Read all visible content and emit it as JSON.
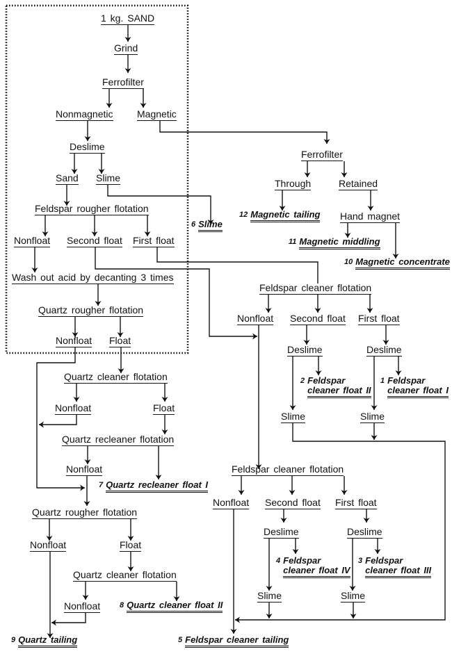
{
  "nodes": {
    "sand": "1 kg. SAND",
    "grind": "Grind",
    "ferrofilter": "Ferrofilter",
    "nonmagnetic": "Nonmagnetic",
    "magnetic": "Magnetic",
    "deslime": "Deslime",
    "sand_fraction": "Sand",
    "slime": "Slime",
    "feldspar_rougher": "Feldspar rougher flotation",
    "nonfloat": "Nonfloat",
    "second_float": "Second float",
    "first_float": "First float",
    "wash": "Wash out acid by decanting 3 times",
    "quartz_rougher": "Quartz rougher flotation",
    "float": "Float",
    "quartz_cleaner": "Quartz cleaner flotation",
    "quartz_recleaner": "Quartz recleaner flotation",
    "through": "Through",
    "retained": "Retained",
    "hand_magnet": "Hand magnet",
    "feldspar_cleaner": "Feldspar cleaner flotation"
  },
  "products": [
    {
      "num": "1",
      "line1": "Feldspar",
      "line2": "cleaner float I"
    },
    {
      "num": "2",
      "line1": "Feldspar",
      "line2": "cleaner float II"
    },
    {
      "num": "3",
      "line1": "Feldspar",
      "line2": "cleaner float III"
    },
    {
      "num": "4",
      "line1": "Feldspar",
      "line2": "cleaner float IV"
    },
    {
      "num": "5",
      "label": "Feldspar cleaner tailing"
    },
    {
      "num": "6",
      "label": "Slime"
    },
    {
      "num": "7",
      "label": "Quartz recleaner float I"
    },
    {
      "num": "8",
      "label": "Quartz cleaner float II"
    },
    {
      "num": "9",
      "label": "Quartz tailing"
    },
    {
      "num": "10",
      "label": "Magnetic concentrate"
    },
    {
      "num": "11",
      "label": "Magnetic middling"
    },
    {
      "num": "12",
      "label": "Magnetic tailing"
    }
  ]
}
